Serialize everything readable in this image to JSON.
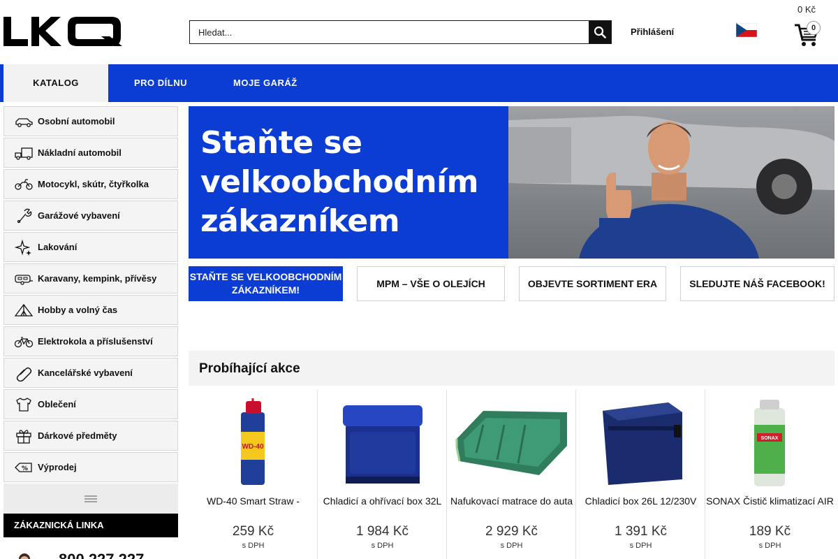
{
  "header": {
    "logo_text": "LKQ",
    "search_placeholder": "Hledat...",
    "login_label": "Přihlášení",
    "cart_price": "0 Kč",
    "cart_count": "0"
  },
  "nav": {
    "items": [
      {
        "label": "KATALOG"
      },
      {
        "label": "PRO DÍLNU"
      },
      {
        "label": "MOJE GARÁŽ"
      }
    ]
  },
  "sidebar": {
    "items": [
      {
        "label": "Osobní automobil",
        "icon": "car-icon"
      },
      {
        "label": "Nákladní automobil",
        "icon": "truck-icon"
      },
      {
        "label": "Motocykl, skútr, čtyřkolka",
        "icon": "motorcycle-icon"
      },
      {
        "label": "Garážové vybavení",
        "icon": "wrench-icon"
      },
      {
        "label": "Lakování",
        "icon": "sparkle-icon"
      },
      {
        "label": "Karavany, kempink, přívěsy",
        "icon": "caravan-icon"
      },
      {
        "label": "Hobby a volný čas",
        "icon": "tent-icon"
      },
      {
        "label": "Elektrokola a příslušenství",
        "icon": "bicycle-icon"
      },
      {
        "label": "Kancelářské vybavení",
        "icon": "paperclip-icon"
      },
      {
        "label": "Oblečení",
        "icon": "tshirt-icon"
      },
      {
        "label": "Dárkové předměty",
        "icon": "gift-icon"
      },
      {
        "label": "Výprodej",
        "icon": "sale-tag-icon"
      }
    ],
    "hotline_label": "ZÁKAZNICKÁ LINKA",
    "hotline_number": "800 227 227"
  },
  "banner": {
    "line1": "Staňte se",
    "line2": "velkoobchodním",
    "line3": "zákazníkem"
  },
  "promos": [
    {
      "label": "STAŇTE SE VELKOOBCHODNÍM ZÁKAZNÍKEM!"
    },
    {
      "label": "MPM – VŠE O OLEJÍCH"
    },
    {
      "label": "OBJEVTE SORTIMENT ERA"
    },
    {
      "label": "SLEDUJTE NÁŠ FACEBOOK!"
    }
  ],
  "section": {
    "title": "Probíhající akce"
  },
  "products": [
    {
      "name": "WD-40 Smart Straw -",
      "price": "259 Kč",
      "vat": "s DPH"
    },
    {
      "name": "Chladicí a ohřívací box 32L",
      "price": "1 984 Kč",
      "vat": "s DPH"
    },
    {
      "name": "Nafukovací matrace do auta",
      "price": "2 929 Kč",
      "vat": "s DPH"
    },
    {
      "name": "Chladicí box 26L 12/230V",
      "price": "1 391 Kč",
      "vat": "s DPH"
    },
    {
      "name": "SONAX Čistič klimatizací AIR",
      "price": "189 Kč",
      "vat": "s DPH"
    }
  ],
  "colors": {
    "brand_blue": "#0b3dd4",
    "black": "#000000"
  }
}
